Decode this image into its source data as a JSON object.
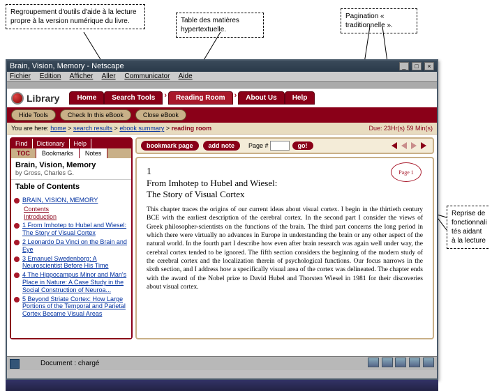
{
  "annotations": {
    "tools_group": "Regroupement d'outils d'aide à la lecture propre à la version numérique du livre.",
    "toc_hyper": "Table des matières hypertextuelle.",
    "pagination": "Pagination « traditionnelle ».",
    "reprise": "Reprise de fonctionnali tés aidant à la lecture"
  },
  "window": {
    "title": "Brain, Vision, Memory - Netscape"
  },
  "menubar": {
    "file": "Fichier",
    "edit": "Edition",
    "view": "Afficher",
    "go": "Aller",
    "comm": "Communicator",
    "help": "Aide"
  },
  "brand": "Library",
  "nav": {
    "home": "Home",
    "search": "Search Tools",
    "reading": "Reading Room",
    "about": "About Us",
    "help": "Help"
  },
  "subnav": {
    "hide": "Hide Tools",
    "checkin": "Check In this eBook",
    "close": "Close eBook"
  },
  "breadcrumb": {
    "label": "You are here:",
    "home": "home",
    "results": "search results",
    "summary": "ebook summary",
    "current": "reading room",
    "due": "Due:  23Hr(s) 59 Min(s)"
  },
  "sidebar": {
    "tabs1": {
      "find": "Find",
      "dict": "Dictionary",
      "help": "Help"
    },
    "tabs2": {
      "toc": "TOC",
      "bm": "Bookmarks",
      "notes": "Notes"
    },
    "book_title": "Brain, Vision, Memory",
    "book_author": "by Gross, Charles G.",
    "toc_heading": "Table of Contents",
    "items": [
      {
        "label": "BRAIN, VISION, MEMORY"
      },
      {
        "label": "1 From Imhotep to Hubel and Wiesel: The Story of Visual Cortex"
      },
      {
        "label": "2 Leonardo Da Vinci on the Brain and Eye"
      },
      {
        "label": "3 Emanuel Swedenborg: A Neuroscientist Before His Time"
      },
      {
        "label": "4 The Hippocampus Minor and Man's Place in Nature: A Case Study in the Social Construction of Neuroa..."
      },
      {
        "label": "5 Beyond Striate Cortex: How Large Portions of the Temporal and Parietal Cortex Became Visual Areas"
      }
    ],
    "subs": {
      "contents": "Contents",
      "intro": "Introduction"
    }
  },
  "toolbar": {
    "bookmark": "bookmark page",
    "addnote": "add note",
    "page_label": "Page #",
    "go": "go!"
  },
  "page": {
    "stamp": "Page 1",
    "chapter_num": "1",
    "title_line1": "From Imhotep to Hubel and Wiesel:",
    "title_line2": "The Story of Visual Cortex",
    "body": "This chapter traces the origins of our current ideas about visual cortex. I begin in the thirtieth century BCE with the earliest description of the cerebral cortex. In the second part I consider the views of Greek philosopher-scientists on the functions of the brain. The third part concerns the long period in which there were virtually no advances in Europe in understanding the brain or any other aspect of the natural world. In the fourth part I describe how even after brain research was again well under way, the cerebral cortex tended to be ignored. The fifth section considers the beginning of the modern study of the cerebral cortex and the localization therein of psychological functions. Our focus narrows in the sixth section, and I address how a specifically visual area of the cortex was delineated. The chapter ends with the award of the Nobel prize to David Hubel and Thorsten Wiesel in 1981 for their discoveries about visual cortex."
  },
  "status": {
    "doc": "Document : chargé"
  }
}
